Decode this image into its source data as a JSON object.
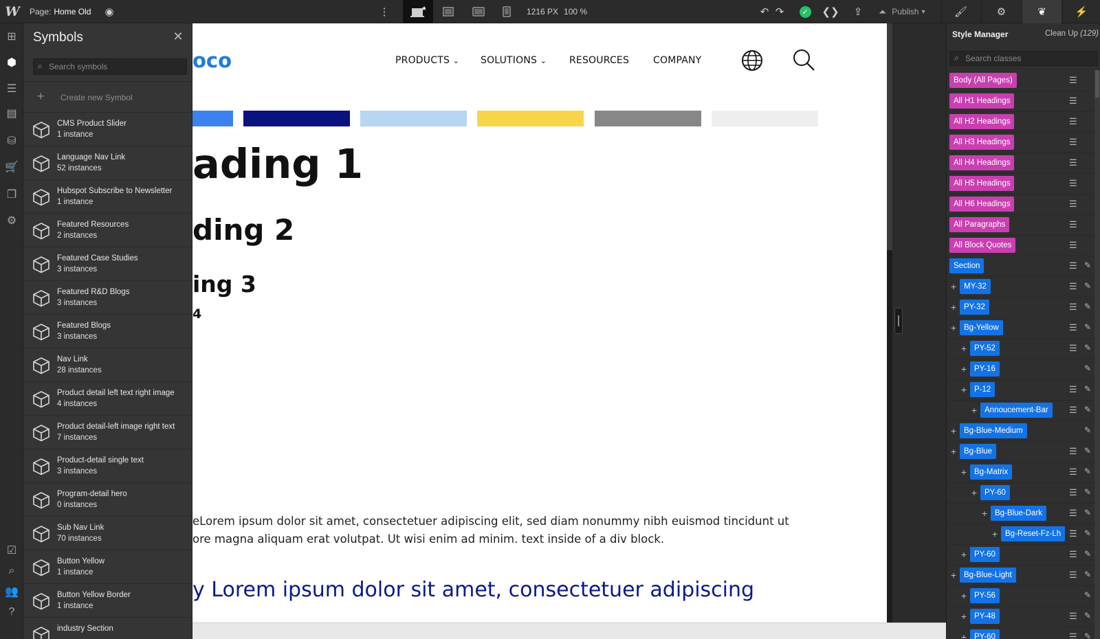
{
  "topbar": {
    "logo": "W",
    "page_prefix": "Page:",
    "page_name": "Home Old",
    "canvas_width": "1216 PX",
    "zoom": "100 %",
    "publish_label": "Publish"
  },
  "symbols_panel": {
    "title": "Symbols",
    "search_placeholder": "Search symbols",
    "create_label": "Create new Symbol",
    "items": [
      {
        "name": "CMS Product Slider",
        "count": "1 instance"
      },
      {
        "name": "Language Nav Link",
        "count": "52 instances"
      },
      {
        "name": "Hubspot Subscribe to Newsletter",
        "count": "1 instance"
      },
      {
        "name": "Featured Resources",
        "count": "2 instances"
      },
      {
        "name": "Featured Case Studies",
        "count": "3 instances"
      },
      {
        "name": "Featured R&D Blogs",
        "count": "3 instances"
      },
      {
        "name": "Featured Blogs",
        "count": "3 instances"
      },
      {
        "name": "Nav Link",
        "count": "28 instances"
      },
      {
        "name": "Product detail left text right image",
        "count": "4 instances"
      },
      {
        "name": "Product detail-left image right text",
        "count": "7 instances"
      },
      {
        "name": "Product-detail single text",
        "count": "3 instances"
      },
      {
        "name": "Program-detail hero",
        "count": "0 instances"
      },
      {
        "name": "Sub Nav Link",
        "count": "70 instances"
      },
      {
        "name": "Button Yellow",
        "count": "1 instance"
      },
      {
        "name": "Button Yellow Border",
        "count": "1 instance"
      },
      {
        "name": "industry Section",
        "count": ""
      }
    ]
  },
  "canvas": {
    "logo_fragment": "oco",
    "nav": [
      "PRODUCTS",
      "SOLUTIONS",
      "RESOURCES",
      "COMPANY"
    ],
    "swatches": [
      "#3b82f0",
      "#0a1280",
      "#b7d6f2",
      "#f7d54a",
      "#878787",
      "#eeeeee"
    ],
    "h1": "ading 1",
    "h2": "ding 2",
    "h3": "ing 3",
    "h4": "4",
    "paragraph_line1": "eLorem ipsum dolor sit amet, consectetuer adipiscing elit, sed diam nonummy nibh euismod tincidunt ut",
    "paragraph_line2": "ore magna aliquam erat volutpat. Ut wisi enim ad minim. text inside of a div block.",
    "blue_text": "y Lorem ipsum dolor sit amet, consectetuer adipiscing"
  },
  "style_manager": {
    "title": "Style Manager",
    "clean_up_label": "Clean Up",
    "clean_up_count": "(129)",
    "search_placeholder": "Search classes",
    "tag_color": "#c93fb0",
    "class_color": "#1373e6",
    "rows": [
      {
        "label": "Body (All Pages)",
        "kind": "tag",
        "indent": 0,
        "toggle": false,
        "list": true,
        "brush": false
      },
      {
        "label": "All H1 Headings",
        "kind": "tag",
        "indent": 0,
        "toggle": false,
        "list": true,
        "brush": false
      },
      {
        "label": "All H2 Headings",
        "kind": "tag",
        "indent": 0,
        "toggle": false,
        "list": true,
        "brush": false
      },
      {
        "label": "All H3 Headings",
        "kind": "tag",
        "indent": 0,
        "toggle": false,
        "list": true,
        "brush": false
      },
      {
        "label": "All H4 Headings",
        "kind": "tag",
        "indent": 0,
        "toggle": false,
        "list": true,
        "brush": false
      },
      {
        "label": "All H5 Headings",
        "kind": "tag",
        "indent": 0,
        "toggle": false,
        "list": true,
        "brush": false
      },
      {
        "label": "All H6 Headings",
        "kind": "tag",
        "indent": 0,
        "toggle": false,
        "list": true,
        "brush": false
      },
      {
        "label": "All Paragraphs",
        "kind": "tag",
        "indent": 0,
        "toggle": false,
        "list": true,
        "brush": false
      },
      {
        "label": "All Block Quotes",
        "kind": "tag",
        "indent": 0,
        "toggle": false,
        "list": true,
        "brush": false
      },
      {
        "label": "Section",
        "kind": "class",
        "indent": 0,
        "toggle": false,
        "list": true,
        "brush": true
      },
      {
        "label": "MY-32",
        "kind": "class",
        "indent": 1,
        "toggle": true,
        "list": true,
        "brush": true
      },
      {
        "label": "PY-32",
        "kind": "class",
        "indent": 1,
        "toggle": true,
        "list": true,
        "brush": true
      },
      {
        "label": "Bg-Yellow",
        "kind": "class",
        "indent": 1,
        "toggle": true,
        "list": true,
        "brush": true
      },
      {
        "label": "PY-52",
        "kind": "class",
        "indent": 2,
        "toggle": true,
        "list": true,
        "brush": true
      },
      {
        "label": "PY-16",
        "kind": "class",
        "indent": 2,
        "toggle": true,
        "list": false,
        "brush": true
      },
      {
        "label": "P-12",
        "kind": "class",
        "indent": 2,
        "toggle": true,
        "list": true,
        "brush": true
      },
      {
        "label": "Annoucement-Bar",
        "kind": "class",
        "indent": 3,
        "toggle": true,
        "list": true,
        "brush": true
      },
      {
        "label": "Bg-Blue-Medium",
        "kind": "class",
        "indent": 1,
        "toggle": true,
        "list": false,
        "brush": true
      },
      {
        "label": "Bg-Blue",
        "kind": "class",
        "indent": 1,
        "toggle": true,
        "list": true,
        "brush": true
      },
      {
        "label": "Bg-Matrix",
        "kind": "class",
        "indent": 2,
        "toggle": true,
        "list": true,
        "brush": true
      },
      {
        "label": "PY-60",
        "kind": "class",
        "indent": 3,
        "toggle": true,
        "list": true,
        "brush": true
      },
      {
        "label": "Bg-Blue-Dark",
        "kind": "class",
        "indent": 4,
        "toggle": true,
        "list": true,
        "brush": true
      },
      {
        "label": "Bg-Reset-Fz-Lh",
        "kind": "class",
        "indent": 5,
        "toggle": true,
        "list": true,
        "brush": true
      },
      {
        "label": "PY-60",
        "kind": "class",
        "indent": 2,
        "toggle": true,
        "list": true,
        "brush": true
      },
      {
        "label": "Bg-Blue-Light",
        "kind": "class",
        "indent": 1,
        "toggle": true,
        "list": true,
        "brush": true
      },
      {
        "label": "PY-56",
        "kind": "class",
        "indent": 2,
        "toggle": true,
        "list": false,
        "brush": true
      },
      {
        "label": "PY-48",
        "kind": "class",
        "indent": 2,
        "toggle": true,
        "list": true,
        "brush": true
      },
      {
        "label": "PY-60",
        "kind": "class",
        "indent": 2,
        "toggle": true,
        "list": true,
        "brush": true
      }
    ]
  }
}
